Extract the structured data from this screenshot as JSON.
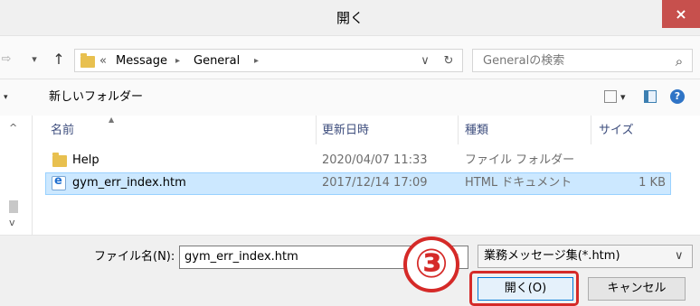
{
  "window": {
    "title": "開く",
    "close_glyph": "×"
  },
  "nav": {
    "back_glyph": "⇨",
    "history_glyph": "▾",
    "up_glyph": "↑",
    "breadcrumb_overflow": "«",
    "breadcrumb": [
      "Message",
      "General"
    ],
    "sep_glyph": "▸",
    "dropdown_glyph": "∨",
    "refresh_glyph": "↻",
    "search_placeholder": "Generalの検索",
    "search_glyph": "⌕"
  },
  "toolbar": {
    "new_folder_label": "新しいフォルダー",
    "view_dropdown_glyph": "▾",
    "help_glyph": "?"
  },
  "sidebar": {
    "up_glyph": "^",
    "down_glyph": "v"
  },
  "columns": {
    "name": "名前",
    "date": "更新日時",
    "type": "種類",
    "size": "サイズ"
  },
  "files": [
    {
      "name": "Help",
      "date": "2020/04/07 11:33",
      "type": "ファイル フォルダー",
      "size": "",
      "icon": "folder-icon",
      "selected": false
    },
    {
      "name": "gym_err_index.htm",
      "date": "2017/12/14 17:09",
      "type": "HTML ドキュメント",
      "size": "1 KB",
      "icon": "ie-document-icon",
      "selected": true
    }
  ],
  "footer": {
    "filename_label": "ファイル名(N):",
    "filename_value": "gym_err_index.htm",
    "filetype_value": "業務メッセージ集(*.htm)",
    "open_label": "開く(O)",
    "cancel_label": "キャンセル",
    "step_marker": "③",
    "highlight_color": "#d52a28"
  }
}
